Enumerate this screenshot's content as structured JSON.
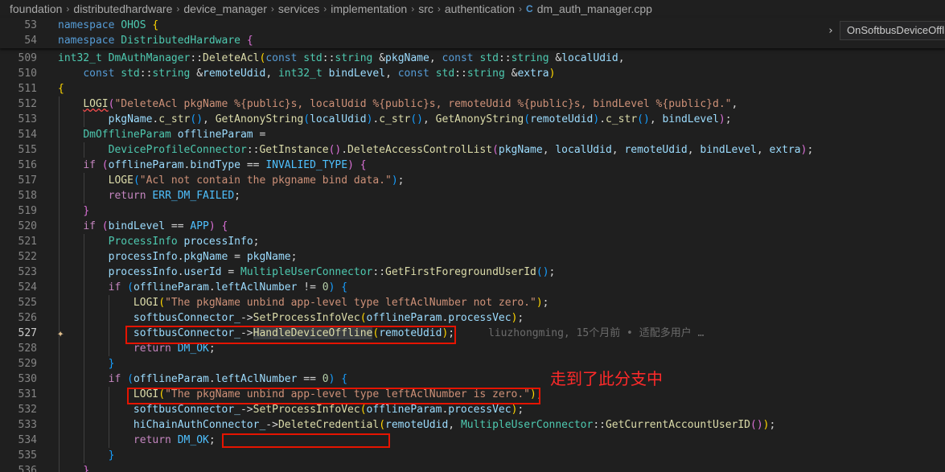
{
  "breadcrumb": [
    "foundation",
    "distributedhardware",
    "device_manager",
    "services",
    "implementation",
    "src",
    "authentication"
  ],
  "breadcrumb_file": "dm_auth_manager.cpp",
  "breadcrumb_separator": "›",
  "file_icon": "C",
  "sticky_scroll": [
    {
      "ln": "53",
      "tokens": [
        [
          "kw",
          "namespace"
        ],
        [
          "pn",
          " "
        ],
        [
          "ty",
          "OHOS"
        ],
        [
          "pn",
          " "
        ],
        [
          "br1",
          "{"
        ]
      ]
    },
    {
      "ln": "54",
      "tokens": [
        [
          "kw",
          "namespace"
        ],
        [
          "pn",
          " "
        ],
        [
          "ty",
          "DistributedHardware"
        ],
        [
          "pn",
          " "
        ],
        [
          "br2",
          "{"
        ]
      ]
    }
  ],
  "symbol_search": {
    "chevron": "›",
    "value": "OnSoftbusDeviceOffline"
  },
  "code_lines": [
    {
      "ln": "509",
      "indent": 0,
      "tokens": [
        [
          "ty",
          "int32_t"
        ],
        [
          "pn",
          " "
        ],
        [
          "ty",
          "DmAuthManager"
        ],
        [
          "pn",
          "::"
        ],
        [
          "fn",
          "DeleteAcl"
        ],
        [
          "br1",
          "("
        ],
        [
          "kw",
          "const"
        ],
        [
          "pn",
          " "
        ],
        [
          "ty",
          "std"
        ],
        [
          "pn",
          "::"
        ],
        [
          "ty",
          "string"
        ],
        [
          "pn",
          " &"
        ],
        [
          "var",
          "pkgName"
        ],
        [
          "pn",
          ", "
        ],
        [
          "kw",
          "const"
        ],
        [
          "pn",
          " "
        ],
        [
          "ty",
          "std"
        ],
        [
          "pn",
          "::"
        ],
        [
          "ty",
          "string"
        ],
        [
          "pn",
          " &"
        ],
        [
          "var",
          "localUdid"
        ],
        [
          "pn",
          ","
        ]
      ]
    },
    {
      "ln": "510",
      "indent": 0,
      "tokens": [
        [
          "pn",
          "    "
        ],
        [
          "kw",
          "const"
        ],
        [
          "pn",
          " "
        ],
        [
          "ty",
          "std"
        ],
        [
          "pn",
          "::"
        ],
        [
          "ty",
          "string"
        ],
        [
          "pn",
          " &"
        ],
        [
          "var",
          "remoteUdid"
        ],
        [
          "pn",
          ", "
        ],
        [
          "ty",
          "int32_t"
        ],
        [
          "pn",
          " "
        ],
        [
          "var",
          "bindLevel"
        ],
        [
          "pn",
          ", "
        ],
        [
          "kw",
          "const"
        ],
        [
          "pn",
          " "
        ],
        [
          "ty",
          "std"
        ],
        [
          "pn",
          "::"
        ],
        [
          "ty",
          "string"
        ],
        [
          "pn",
          " &"
        ],
        [
          "var",
          "extra"
        ],
        [
          "br1",
          ")"
        ]
      ]
    },
    {
      "ln": "511",
      "indent": 0,
      "tokens": [
        [
          "br1",
          "{"
        ]
      ]
    },
    {
      "ln": "512",
      "indent": 1,
      "tokens": [
        [
          "fn squig",
          "LOGI"
        ],
        [
          "br2",
          "("
        ],
        [
          "str",
          "\"DeleteAcl pkgName %{public}s, localUdid %{public}s, remoteUdid %{public}s, bindLevel %{public}d.\""
        ],
        [
          "pn",
          ","
        ]
      ]
    },
    {
      "ln": "513",
      "indent": 2,
      "tokens": [
        [
          "var",
          "pkgName"
        ],
        [
          "pn",
          "."
        ],
        [
          "fn",
          "c_str"
        ],
        [
          "br3",
          "()"
        ],
        [
          "pn",
          ", "
        ],
        [
          "fn",
          "GetAnonyString"
        ],
        [
          "br3",
          "("
        ],
        [
          "var",
          "localUdid"
        ],
        [
          "br3",
          ")"
        ],
        [
          "pn",
          "."
        ],
        [
          "fn",
          "c_str"
        ],
        [
          "br3",
          "()"
        ],
        [
          "pn",
          ", "
        ],
        [
          "fn",
          "GetAnonyString"
        ],
        [
          "br3",
          "("
        ],
        [
          "var",
          "remoteUdid"
        ],
        [
          "br3",
          ")"
        ],
        [
          "pn",
          "."
        ],
        [
          "fn",
          "c_str"
        ],
        [
          "br3",
          "()"
        ],
        [
          "pn",
          ", "
        ],
        [
          "var",
          "bindLevel"
        ],
        [
          "br2",
          ")"
        ],
        [
          "pn",
          ";"
        ]
      ]
    },
    {
      "ln": "514",
      "indent": 1,
      "tokens": [
        [
          "ty",
          "DmOfflineParam"
        ],
        [
          "pn",
          " "
        ],
        [
          "var",
          "offlineParam"
        ],
        [
          "pn",
          " ="
        ]
      ]
    },
    {
      "ln": "515",
      "indent": 2,
      "tokens": [
        [
          "ty",
          "DeviceProfileConnector"
        ],
        [
          "pn",
          "::"
        ],
        [
          "fn",
          "GetInstance"
        ],
        [
          "br2",
          "()"
        ],
        [
          "pn",
          "."
        ],
        [
          "fn",
          "DeleteAccessControlList"
        ],
        [
          "br2",
          "("
        ],
        [
          "var",
          "pkgName"
        ],
        [
          "pn",
          ", "
        ],
        [
          "var",
          "localUdid"
        ],
        [
          "pn",
          ", "
        ],
        [
          "var",
          "remoteUdid"
        ],
        [
          "pn",
          ", "
        ],
        [
          "var",
          "bindLevel"
        ],
        [
          "pn",
          ", "
        ],
        [
          "var",
          "extra"
        ],
        [
          "br2",
          ")"
        ],
        [
          "pn",
          ";"
        ]
      ]
    },
    {
      "ln": "516",
      "indent": 1,
      "tokens": [
        [
          "ctl",
          "if"
        ],
        [
          "pn",
          " "
        ],
        [
          "br2",
          "("
        ],
        [
          "var",
          "offlineParam"
        ],
        [
          "pn",
          "."
        ],
        [
          "var",
          "bindType"
        ],
        [
          "pn",
          " == "
        ],
        [
          "cst",
          "INVALIED_TYPE"
        ],
        [
          "br2",
          ")"
        ],
        [
          "pn",
          " "
        ],
        [
          "br2",
          "{"
        ]
      ]
    },
    {
      "ln": "517",
      "indent": 2,
      "tokens": [
        [
          "fn",
          "LOGE"
        ],
        [
          "br3",
          "("
        ],
        [
          "str",
          "\"Acl not contain the pkgname bind data.\""
        ],
        [
          "br3",
          ")"
        ],
        [
          "pn",
          ";"
        ]
      ]
    },
    {
      "ln": "518",
      "indent": 2,
      "tokens": [
        [
          "ctl",
          "return"
        ],
        [
          "pn",
          " "
        ],
        [
          "cst",
          "ERR_DM_FAILED"
        ],
        [
          "pn",
          ";"
        ]
      ]
    },
    {
      "ln": "519",
      "indent": 1,
      "tokens": [
        [
          "br2",
          "}"
        ]
      ]
    },
    {
      "ln": "520",
      "indent": 1,
      "tokens": [
        [
          "ctl",
          "if"
        ],
        [
          "pn",
          " "
        ],
        [
          "br2",
          "("
        ],
        [
          "var",
          "bindLevel"
        ],
        [
          "pn",
          " == "
        ],
        [
          "cst",
          "APP"
        ],
        [
          "br2",
          ")"
        ],
        [
          "pn",
          " "
        ],
        [
          "br2",
          "{"
        ]
      ]
    },
    {
      "ln": "521",
      "indent": 2,
      "tokens": [
        [
          "ty",
          "ProcessInfo"
        ],
        [
          "pn",
          " "
        ],
        [
          "var",
          "processInfo"
        ],
        [
          "pn",
          ";"
        ]
      ]
    },
    {
      "ln": "522",
      "indent": 2,
      "tokens": [
        [
          "var",
          "processInfo"
        ],
        [
          "pn",
          "."
        ],
        [
          "var",
          "pkgName"
        ],
        [
          "pn",
          " = "
        ],
        [
          "var",
          "pkgName"
        ],
        [
          "pn",
          ";"
        ]
      ]
    },
    {
      "ln": "523",
      "indent": 2,
      "tokens": [
        [
          "var",
          "processInfo"
        ],
        [
          "pn",
          "."
        ],
        [
          "var",
          "userId"
        ],
        [
          "pn",
          " = "
        ],
        [
          "ty",
          "MultipleUserConnector"
        ],
        [
          "pn",
          "::"
        ],
        [
          "fn",
          "GetFirstForegroundUserId"
        ],
        [
          "br3",
          "()"
        ],
        [
          "pn",
          ";"
        ]
      ]
    },
    {
      "ln": "524",
      "indent": 2,
      "tokens": [
        [
          "ctl",
          "if"
        ],
        [
          "pn",
          " "
        ],
        [
          "br3",
          "("
        ],
        [
          "var",
          "offlineParam"
        ],
        [
          "pn",
          "."
        ],
        [
          "var",
          "leftAclNumber"
        ],
        [
          "pn",
          " != "
        ],
        [
          "num",
          "0"
        ],
        [
          "br3",
          ")"
        ],
        [
          "pn",
          " "
        ],
        [
          "br3",
          "{"
        ]
      ]
    },
    {
      "ln": "525",
      "indent": 3,
      "tokens": [
        [
          "fn",
          "LOGI"
        ],
        [
          "br1",
          "("
        ],
        [
          "str",
          "\"The pkgName unbind app-level type leftAclNumber not zero.\""
        ],
        [
          "br1",
          ")"
        ],
        [
          "pn",
          ";"
        ]
      ]
    },
    {
      "ln": "526",
      "indent": 3,
      "tokens": [
        [
          "var",
          "softbusConnector_"
        ],
        [
          "pn",
          "->"
        ],
        [
          "fn",
          "SetProcessInfoVec"
        ],
        [
          "br1",
          "("
        ],
        [
          "var",
          "offlineParam"
        ],
        [
          "pn",
          "."
        ],
        [
          "var",
          "processVec"
        ],
        [
          "br1",
          ")"
        ],
        [
          "pn",
          ";"
        ]
      ]
    },
    {
      "ln": "527",
      "indent": 3,
      "active": true,
      "sparkle": true,
      "tokens": [
        [
          "var",
          "softbusConnector_"
        ],
        [
          "pn",
          "->"
        ],
        [
          "fn hl",
          "HandleDeviceOffline"
        ],
        [
          "br1",
          "("
        ],
        [
          "var",
          "remoteUdid"
        ],
        [
          "br1",
          ")"
        ],
        [
          "pn",
          ";"
        ]
      ],
      "blame": "liuzhongming, 15个月前 • 适配多用户 …"
    },
    {
      "ln": "528",
      "indent": 3,
      "tokens": [
        [
          "ctl",
          "return"
        ],
        [
          "pn",
          " "
        ],
        [
          "cst",
          "DM_OK"
        ],
        [
          "pn",
          ";"
        ]
      ]
    },
    {
      "ln": "529",
      "indent": 2,
      "tokens": [
        [
          "br3",
          "}"
        ]
      ]
    },
    {
      "ln": "530",
      "indent": 2,
      "tokens": [
        [
          "ctl",
          "if"
        ],
        [
          "pn",
          " "
        ],
        [
          "br3",
          "("
        ],
        [
          "var",
          "offlineParam"
        ],
        [
          "pn",
          "."
        ],
        [
          "var",
          "leftAclNumber"
        ],
        [
          "pn",
          " == "
        ],
        [
          "num",
          "0"
        ],
        [
          "br3",
          ")"
        ],
        [
          "pn",
          " "
        ],
        [
          "br3",
          "{"
        ]
      ]
    },
    {
      "ln": "531",
      "indent": 3,
      "tokens": [
        [
          "fn",
          "LOGI"
        ],
        [
          "br1",
          "("
        ],
        [
          "str",
          "\"The pkgName unbind app-level type leftAclNumber is zero.\""
        ],
        [
          "br1",
          ")"
        ],
        [
          "pn",
          ";"
        ]
      ]
    },
    {
      "ln": "532",
      "indent": 3,
      "tokens": [
        [
          "var",
          "softbusConnector_"
        ],
        [
          "pn",
          "->"
        ],
        [
          "fn",
          "SetProcessInfoVec"
        ],
        [
          "br1",
          "("
        ],
        [
          "var",
          "offlineParam"
        ],
        [
          "pn",
          "."
        ],
        [
          "var",
          "processVec"
        ],
        [
          "br1",
          ")"
        ],
        [
          "pn",
          ";"
        ]
      ]
    },
    {
      "ln": "533",
      "indent": 3,
      "tokens": [
        [
          "var",
          "hiChainAuthConnector_"
        ],
        [
          "pn",
          "->"
        ],
        [
          "fn",
          "DeleteCredential"
        ],
        [
          "br1",
          "("
        ],
        [
          "var",
          "remoteUdid"
        ],
        [
          "pn",
          ", "
        ],
        [
          "ty",
          "MultipleUserConnector"
        ],
        [
          "pn",
          "::"
        ],
        [
          "fn",
          "GetCurrentAccountUserID"
        ],
        [
          "br2",
          "()"
        ],
        [
          "br1",
          ")"
        ],
        [
          "pn",
          ";"
        ]
      ]
    },
    {
      "ln": "534",
      "indent": 3,
      "tokens": [
        [
          "ctl",
          "return"
        ],
        [
          "pn",
          " "
        ],
        [
          "cst",
          "DM_OK"
        ],
        [
          "pn",
          ";"
        ]
      ]
    },
    {
      "ln": "535",
      "indent": 2,
      "tokens": [
        [
          "br3",
          "}"
        ]
      ]
    },
    {
      "ln": "536",
      "indent": 1,
      "tokens": [
        [
          "br2",
          "}"
        ]
      ]
    }
  ],
  "annotation": "走到了此分支中",
  "colors": {
    "editor_bg": "#1f1f1f",
    "keyword": "#569cd6",
    "control": "#c586c0",
    "type": "#4ec9b0",
    "function": "#dcdcaa",
    "variable": "#9cdcfe",
    "string": "#ce9178",
    "highlight_box": "#e51400",
    "annotation": "#ff2a2a"
  }
}
